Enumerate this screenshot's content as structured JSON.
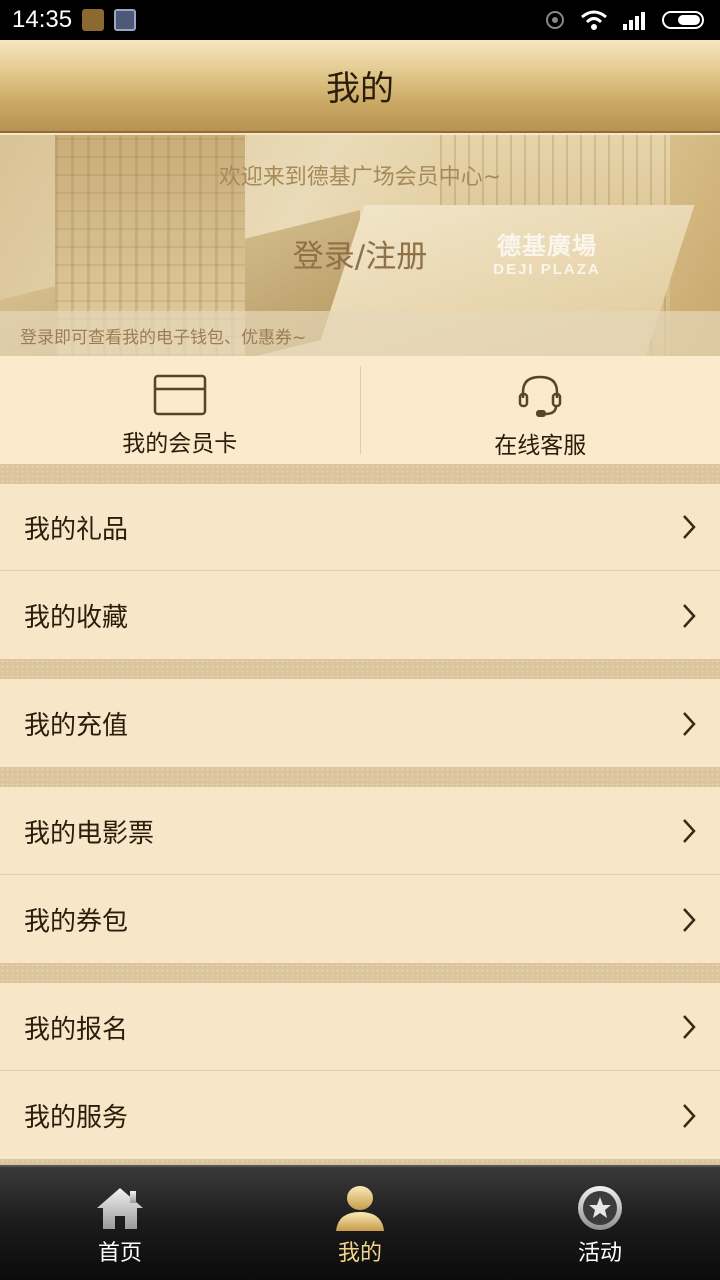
{
  "status_bar": {
    "time": "14:35"
  },
  "header": {
    "title": "我的"
  },
  "banner": {
    "welcome": "欢迎来到德基广场会员中心~",
    "login": "登录/注册",
    "hint": "登录即可查看我的电子钱包、优惠券~",
    "logo_cn": "德基廣場",
    "logo_en": "DEJI PLAZA"
  },
  "quick_actions": [
    {
      "label": "我的会员卡",
      "icon": "card-icon"
    },
    {
      "label": "在线客服",
      "icon": "headset-icon"
    }
  ],
  "menu": {
    "gift": "我的礼品",
    "favorites": "我的收藏",
    "recharge": "我的充值",
    "movie_tickets": "我的电影票",
    "coupons": "我的券包",
    "registration": "我的报名",
    "services": "我的服务"
  },
  "bottom_nav": [
    {
      "label": "首页",
      "icon": "home-icon",
      "active": false
    },
    {
      "label": "我的",
      "icon": "user-icon",
      "active": true
    },
    {
      "label": "活动",
      "icon": "star-icon",
      "active": false
    }
  ],
  "colors": {
    "background": "#f7e7c9",
    "separator": "#dcc59c",
    "active_nav": "#f3d48a"
  }
}
